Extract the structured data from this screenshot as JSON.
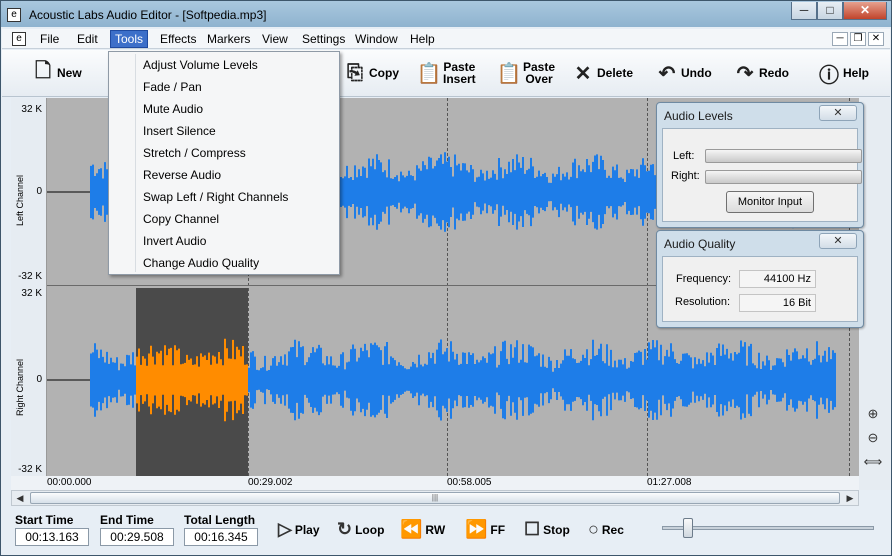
{
  "window": {
    "title": "Acoustic Labs Audio Editor - [Softpedia.mp3]",
    "controls": [
      "─",
      "□",
      "✕"
    ]
  },
  "menu": [
    "File",
    "Edit",
    "Tools",
    "Effects",
    "Markers",
    "View",
    "Settings",
    "Window",
    "Help"
  ],
  "menu_active": "Tools",
  "tools_menu": [
    "Adjust Volume Levels",
    "Fade / Pan",
    "Mute Audio",
    "Insert Silence",
    "Stretch / Compress",
    "Reverse Audio",
    "Swap Left / Right Channels",
    "Copy Channel",
    "Invert Audio",
    "Change Audio Quality"
  ],
  "toolbar": {
    "new": "New",
    "copy": "Copy",
    "paste_insert": [
      "Paste",
      "Insert"
    ],
    "paste_over": [
      "Paste",
      "Over"
    ],
    "delete": "Delete",
    "undo": "Undo",
    "redo": "Redo",
    "help": "Help"
  },
  "channels": {
    "left_label": "Left Channel",
    "right_label": "Right Channel",
    "y_top": "32 K",
    "y_mid": "0",
    "y_bot": "-32 K"
  },
  "timeline": [
    "00:00.000",
    "00:29.002",
    "00:58.005",
    "01:27.008"
  ],
  "transport": {
    "start_label": "Start Time",
    "start_value": "00:13.163",
    "end_label": "End Time",
    "end_value": "00:29.508",
    "total_label": "Total Length",
    "total_value": "00:16.345",
    "play": "Play",
    "loop": "Loop",
    "rw": "RW",
    "ff": "FF",
    "stop": "Stop",
    "rec": "Rec"
  },
  "audio_levels": {
    "title": "Audio Levels",
    "left": "Left:",
    "right": "Right:",
    "button": "Monitor Input"
  },
  "audio_quality": {
    "title": "Audio Quality",
    "freq_label": "Frequency:",
    "freq_value": "44100 Hz",
    "res_label": "Resolution:",
    "res_value": "16 Bit"
  },
  "colors": {
    "wave": "#1e7de8",
    "selection_wave": "#ff8c00",
    "selection_bg": "#4a4a4a",
    "canvas": "#b2b2b2",
    "menu_highlight": "#3c6fc9"
  }
}
